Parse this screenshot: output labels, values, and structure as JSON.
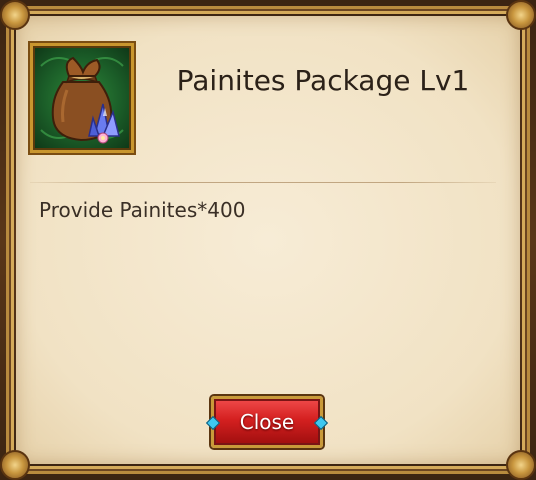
{
  "dialog": {
    "title": "Painites Package Lv1",
    "description": "Provide Painites*400",
    "close_label": "Close",
    "item_icon": "painite-bag-icon"
  },
  "colors": {
    "parchment": "#f3e6cb",
    "frame_gold": "#c9962e",
    "icon_background": "#1b5d28",
    "button_red": "#d42020"
  }
}
